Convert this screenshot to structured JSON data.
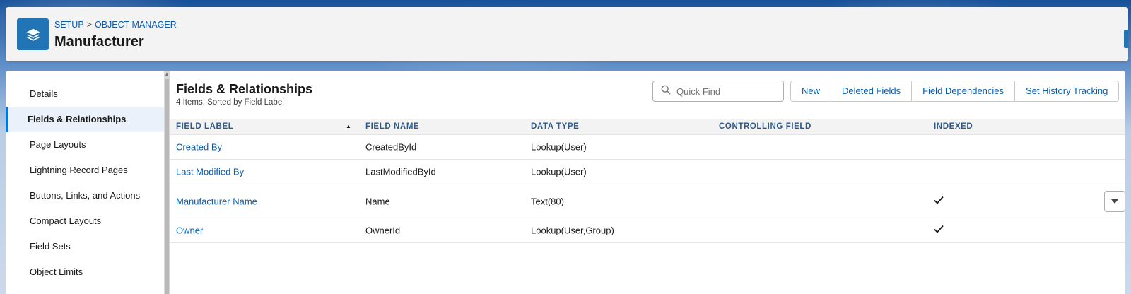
{
  "header": {
    "breadcrumb_root": "SETUP",
    "breadcrumb_sep": ">",
    "breadcrumb_current": "OBJECT MANAGER",
    "title": "Manufacturer",
    "icon": "layers-icon"
  },
  "sidebar": {
    "items": [
      {
        "label": "Details"
      },
      {
        "label": "Fields & Relationships",
        "active": true
      },
      {
        "label": "Page Layouts"
      },
      {
        "label": "Lightning Record Pages"
      },
      {
        "label": "Buttons, Links, and Actions"
      },
      {
        "label": "Compact Layouts"
      },
      {
        "label": "Field Sets"
      },
      {
        "label": "Object Limits"
      }
    ]
  },
  "section": {
    "title": "Fields & Relationships",
    "subtitle": "4 Items, Sorted by Field Label"
  },
  "search": {
    "placeholder": "Quick Find",
    "value": ""
  },
  "buttons": {
    "new": "New",
    "deleted_fields": "Deleted Fields",
    "field_dependencies": "Field Dependencies",
    "set_history_tracking": "Set History Tracking"
  },
  "table": {
    "columns": [
      "FIELD LABEL",
      "FIELD NAME",
      "DATA TYPE",
      "CONTROLLING FIELD",
      "INDEXED"
    ],
    "sorted_by": "FIELD LABEL",
    "sort_direction": "ascending",
    "rows": [
      {
        "field_label": "Created By",
        "field_name": "CreatedById",
        "data_type": "Lookup(User)",
        "controlling_field": "",
        "indexed": false
      },
      {
        "field_label": "Last Modified By",
        "field_name": "LastModifiedById",
        "data_type": "Lookup(User)",
        "controlling_field": "",
        "indexed": false
      },
      {
        "field_label": "Manufacturer Name",
        "field_name": "Name",
        "data_type": "Text(80)",
        "controlling_field": "",
        "indexed": true,
        "row_menu": true
      },
      {
        "field_label": "Owner",
        "field_name": "OwnerId",
        "data_type": "Lookup(User,Group)",
        "controlling_field": "",
        "indexed": true
      }
    ]
  },
  "colors": {
    "brand_blue": "#0176d3",
    "link": "#0b5cab",
    "icon_bg": "#2374b4",
    "header_text": "#2e5a8a"
  }
}
